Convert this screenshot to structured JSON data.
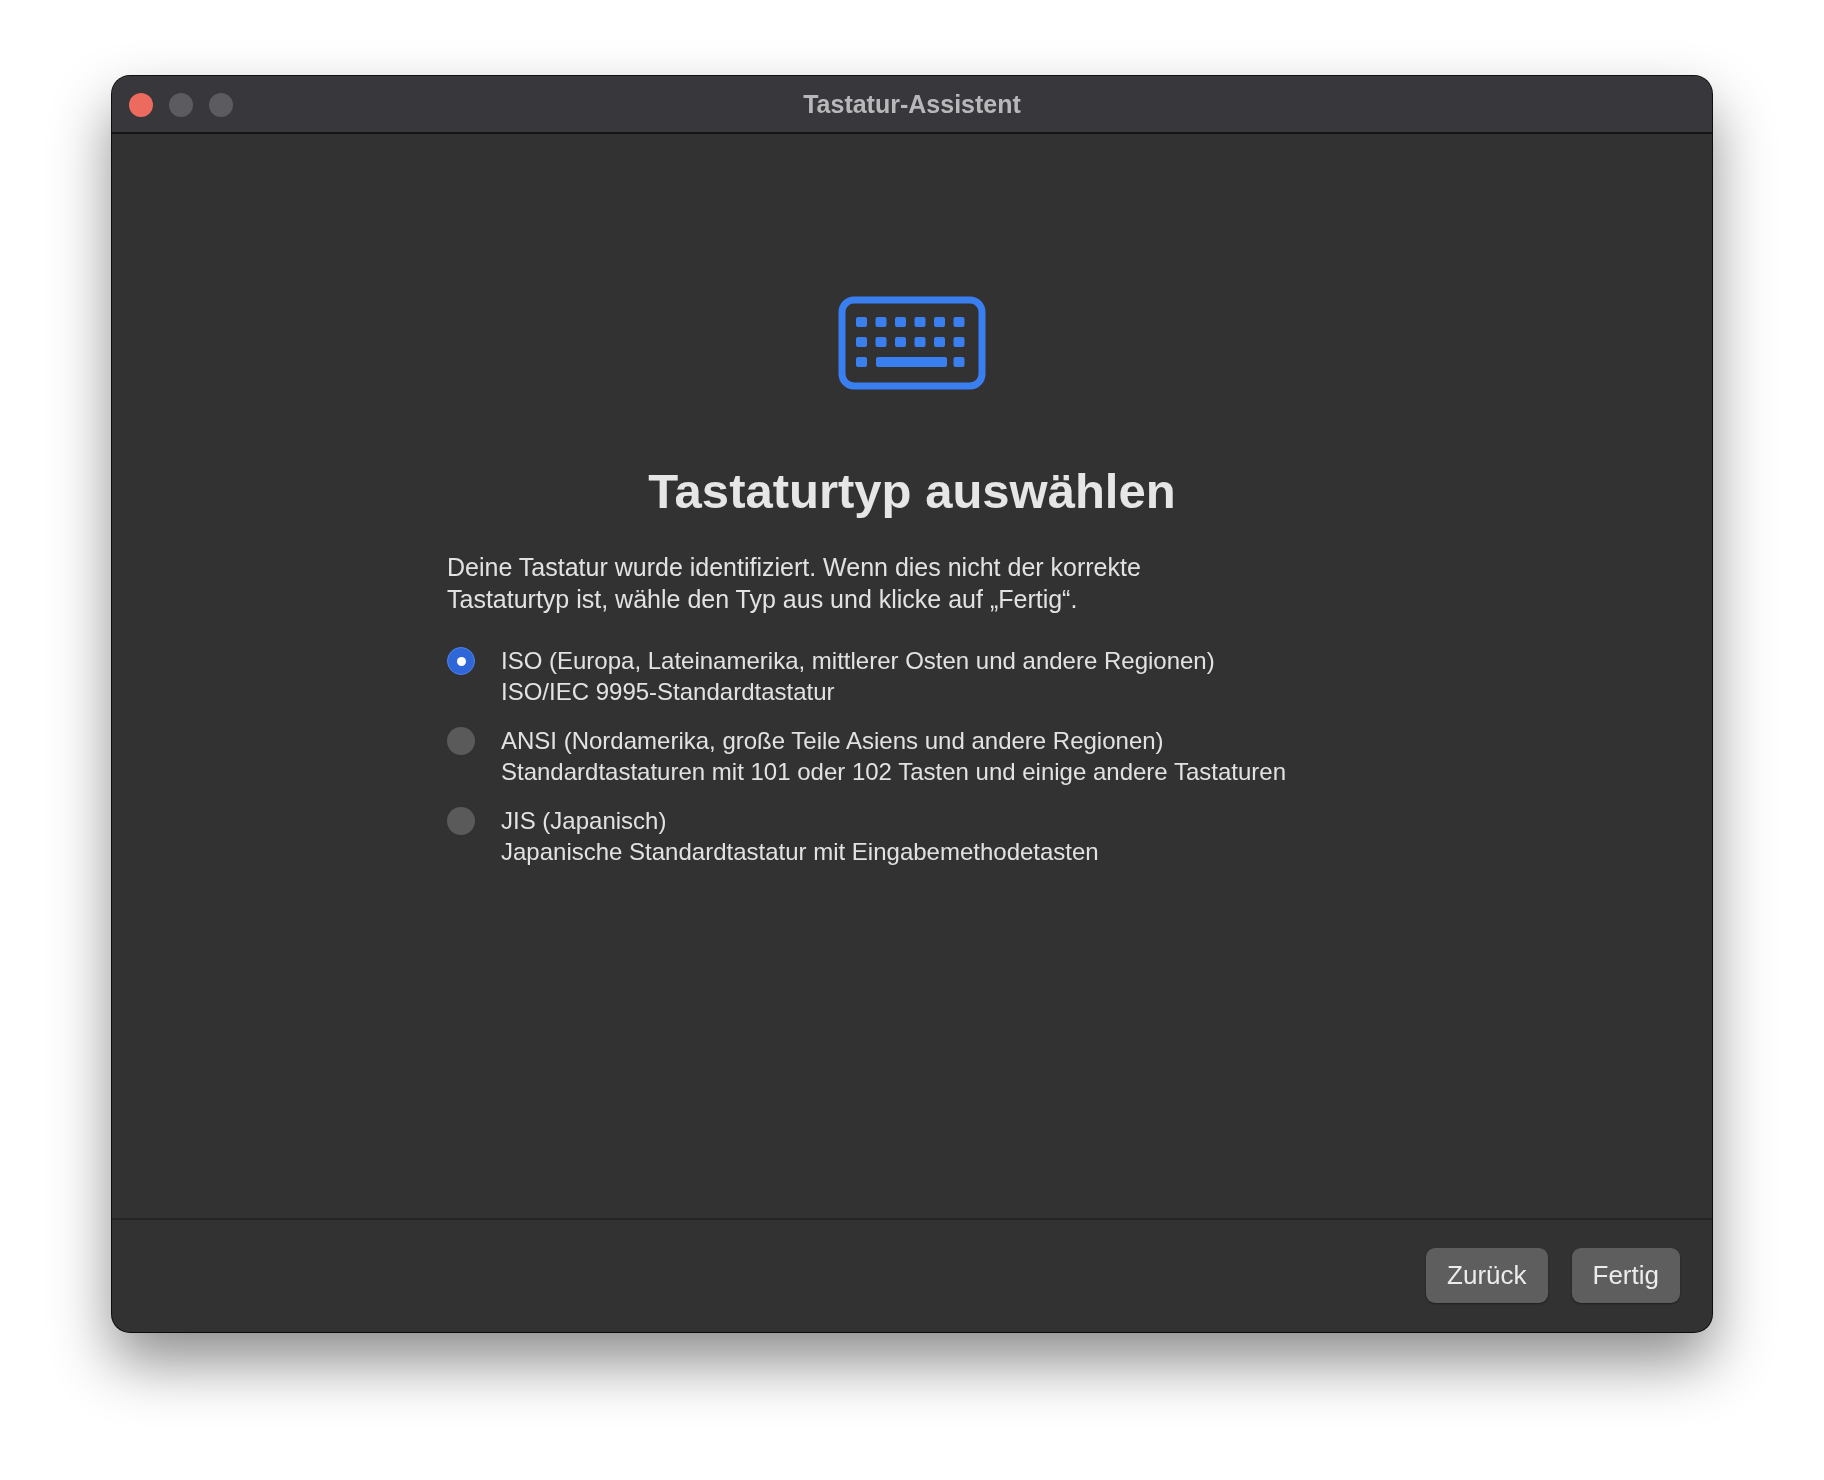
{
  "window": {
    "title": "Tastatur-Assistent"
  },
  "heading": "Tastaturtyp auswählen",
  "description": "Deine Tastatur wurde identifiziert. Wenn dies nicht der korrekte Tastaturtyp ist, wähle den Typ aus und klicke auf „Fertig“.",
  "options": [
    {
      "label": "ISO (Europa, Lateinamerika, mittlerer Osten und andere Regionen)",
      "detail": "ISO/IEC 9995-Standardtastatur",
      "selected": true
    },
    {
      "label": "ANSI (Nordamerika, große Teile Asiens und andere Regionen)",
      "detail": "Standardtastaturen mit 101 oder 102 Tasten und einige andere Tastaturen",
      "selected": false
    },
    {
      "label": "JIS (Japanisch)",
      "detail": "Japanische Standardtastatur mit Eingabemethodetasten",
      "selected": false
    }
  ],
  "buttons": [
    "Zurück",
    "Fertig"
  ]
}
